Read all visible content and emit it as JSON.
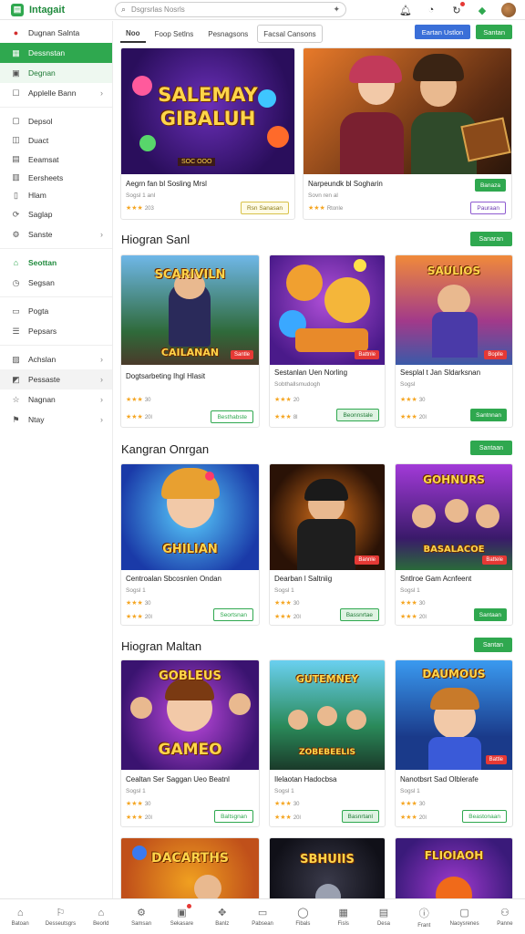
{
  "app": {
    "title": "Intagait"
  },
  "search": {
    "placeholder": "Dsgrsrlas Nosrls"
  },
  "colors": {
    "accent": "#2fa84f",
    "blue": "#3a6fd8",
    "star": "#f5a623",
    "badge": "#e53935"
  },
  "sidebar": {
    "items": [
      {
        "label": "Dugnan Salnta",
        "icon": "record-icon"
      },
      {
        "label": "Dessnstan",
        "icon": "grid-icon"
      },
      {
        "label": "Degnan",
        "icon": "gamepad-icon"
      },
      {
        "label": "Applelle Bann",
        "icon": "square-icon"
      },
      {
        "label": "Depsol",
        "icon": "box-icon"
      },
      {
        "label": "Duact",
        "icon": "tag-icon"
      },
      {
        "label": "Eeamsat",
        "icon": "calendar-icon"
      },
      {
        "label": "Eersheets",
        "icon": "sheet-icon"
      },
      {
        "label": "Hlam",
        "icon": "doc-icon"
      },
      {
        "label": "Saglap",
        "icon": "refresh-icon"
      },
      {
        "label": "Sanste",
        "icon": "gear-icon"
      },
      {
        "label": "Seottan",
        "icon": "home-icon"
      },
      {
        "label": "Segsan",
        "icon": "clock-icon"
      },
      {
        "label": "Pogta",
        "icon": "page-icon"
      },
      {
        "label": "Pepsars",
        "icon": "list-icon"
      },
      {
        "label": "Achslan",
        "icon": "chart-icon"
      },
      {
        "label": "Pessaste",
        "icon": "image-icon"
      },
      {
        "label": "Nagnan",
        "icon": "star-icon"
      },
      {
        "label": "Ntay",
        "icon": "flag-icon"
      }
    ]
  },
  "tabs": [
    "Noo",
    "Foop Setlns",
    "Pesnagsons",
    "Facsal Cansons"
  ],
  "header_buttons": {
    "primary": "Eartan Ustlon",
    "secondary": "Santan"
  },
  "featured": [
    {
      "art": "SALEMAY GIBALUH",
      "art_sub": "SOC OOO",
      "title": "Aegrn fan bl Sosling Mrsl",
      "sub": "Sogsl 1 anl",
      "rating": "★★★",
      "count": "203",
      "btn": "Rsn Sanasan"
    },
    {
      "art": "",
      "title": "Narpeundk bl Sogharin",
      "sub": "Sovn ren al",
      "rating": "★★★",
      "count": "Rtonle",
      "btn": "Banaza",
      "btn2": "Pauraan"
    }
  ],
  "sections": [
    {
      "title": "Hiogran Sanl",
      "button": "Sanaran",
      "cards": [
        {
          "art": "SCARIVILN",
          "art_sub": "CAILANAN",
          "badge": "Santle",
          "title": "Dogtsarbeting Ihgl Hlasit",
          "sub": "",
          "rating": "★★★",
          "count": "30",
          "rating2": "★★★",
          "count2": "20l",
          "btn": "Besthabste"
        },
        {
          "art": "",
          "badge": "Battnle",
          "title": "Sestanlan Uen Norling",
          "sub": "Sobthallsmudogh",
          "rating": "★★★",
          "count": "20",
          "rating2": "★★★",
          "count2": "8l",
          "btn": "Beonnstale"
        },
        {
          "art": "SAULIOS",
          "badge": "Boplle",
          "title": "Sesplal t Jan Sldarksnan",
          "sub": "Sogsl",
          "rating": "★★★",
          "count": "30",
          "rating2": "★★★",
          "count2": "20l",
          "btn": "Santnnan"
        }
      ]
    },
    {
      "title": "Kangran Onrgan",
      "button": "Santaan",
      "cards": [
        {
          "art": "GHILIAN",
          "badge": "",
          "title": "Centroalan Sbcosnlen Ondan",
          "sub": "Sogsl 1",
          "rating": "★★★",
          "count": "30",
          "rating2": "★★★",
          "count2": "20l",
          "btn": "Seortsnan"
        },
        {
          "art": "",
          "badge": "Bannle",
          "title": "Dearban l Saltniig",
          "sub": "Sogsl 1",
          "rating": "★★★",
          "count": "30",
          "rating2": "★★★",
          "count2": "20l",
          "btn": "Bassnrtae"
        },
        {
          "art": "GOHNURS",
          "art_sub": "BASALACOE",
          "badge": "Battele",
          "title": "Sntlroe Gam Acnfeent",
          "sub": "Sogsl 1",
          "rating": "★★★",
          "count": "30",
          "rating2": "★★★",
          "count2": "20l",
          "btn": "Santaan"
        }
      ]
    },
    {
      "title": "Hiogran Maltan",
      "button": "Santan",
      "cards": [
        {
          "art": "GOBLEUS",
          "art_sub": "GAMEO",
          "badge": "",
          "title": "Cealtan Ser Saggan Ueo Beatnl",
          "sub": "Sogsl 1",
          "rating": "★★★",
          "count": "30",
          "rating2": "★★★",
          "count2": "20l",
          "btn": "Baltsgnan"
        },
        {
          "art": "GUTEMNEY",
          "art_sub": "ZOBEBEELIS",
          "badge": "",
          "title": "Ilelaotan Hadocbsa",
          "sub": "Sogsl 1",
          "rating": "★★★",
          "count": "30",
          "rating2": "★★★",
          "count2": "20l",
          "btn": "Basnrtanl"
        },
        {
          "art": "DAUMOUS",
          "badge": "Battle",
          "title": "Nanotbsrt Sad Olblerafe",
          "sub": "Sogsl 1",
          "rating": "★★★",
          "count": "30",
          "rating2": "★★★",
          "count2": "20l",
          "btn": "Beastonaan"
        }
      ]
    },
    {
      "title": "",
      "button": "",
      "cards": [
        {
          "art": "DACARTHS",
          "badge": "",
          "title": "",
          "sub": "",
          "rating": "",
          "count": "",
          "rating2": "",
          "count2": "",
          "btn": ""
        },
        {
          "art": "SBHUIIS",
          "badge": "",
          "title": "",
          "sub": "",
          "rating": "",
          "count": "",
          "rating2": "",
          "count2": "",
          "btn": ""
        },
        {
          "art": "FLIOIAOH",
          "badge": "",
          "title": "",
          "sub": "",
          "rating": "",
          "count": "",
          "rating2": "",
          "count2": "",
          "btn": ""
        }
      ]
    }
  ],
  "bottom_nav": [
    {
      "label": "Batoan",
      "icon": "home-icon"
    },
    {
      "label": "Desseutsgrs",
      "icon": "bookmark-icon"
    },
    {
      "label": "Beorld",
      "icon": "store-icon"
    },
    {
      "label": "Samsan",
      "icon": "settings-icon"
    },
    {
      "label": "Sekasare",
      "icon": "gift-icon"
    },
    {
      "label": "Banlz",
      "icon": "controller-icon"
    },
    {
      "label": "Pabsean",
      "icon": "folder-icon"
    },
    {
      "label": "Fibals",
      "icon": "chat-icon"
    },
    {
      "label": "Fisls",
      "icon": "grid-icon"
    },
    {
      "label": "Desa",
      "icon": "cart-icon"
    },
    {
      "label": "Frant",
      "icon": "info-icon"
    },
    {
      "label": "Naoysrenes",
      "icon": "box-icon"
    },
    {
      "label": "Panne",
      "icon": "people-icon"
    }
  ]
}
